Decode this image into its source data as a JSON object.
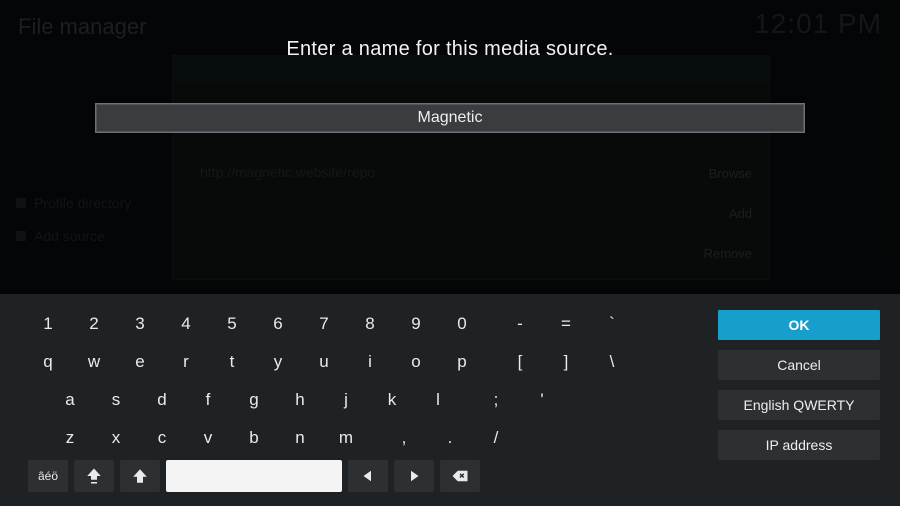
{
  "background": {
    "screen_title": "File manager",
    "clock": "12:01 PM",
    "source_url": "http://magnetic.website/repo",
    "side_items": [
      "Profile directory",
      "Add source"
    ],
    "right_buttons": {
      "browse": "Browse",
      "add": "Add",
      "remove": "Remove"
    }
  },
  "dialog": {
    "prompt": "Enter a name for this media source.",
    "value": "Magnetic"
  },
  "keyboard": {
    "row1": [
      "1",
      "2",
      "3",
      "4",
      "5",
      "6",
      "7",
      "8",
      "9",
      "0",
      "-",
      "=",
      "`"
    ],
    "row2": [
      "q",
      "w",
      "e",
      "r",
      "t",
      "y",
      "u",
      "i",
      "o",
      "p",
      "[",
      "]",
      "\\"
    ],
    "row3": [
      "a",
      "s",
      "d",
      "f",
      "g",
      "h",
      "j",
      "k",
      "l",
      ";",
      "'"
    ],
    "row4": [
      "z",
      "x",
      "c",
      "v",
      "b",
      "n",
      "m",
      ",",
      ".",
      "/"
    ],
    "special": {
      "accents_label": "âéö"
    }
  },
  "side_buttons": {
    "ok": "OK",
    "cancel": "Cancel",
    "layout": "English QWERTY",
    "ip": "IP address"
  }
}
